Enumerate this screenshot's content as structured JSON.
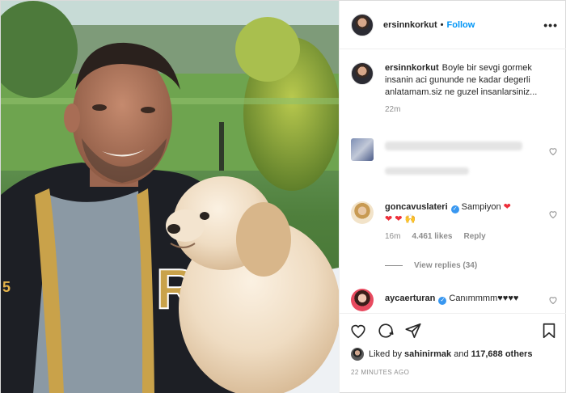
{
  "post": {
    "username": "ersinnkorkut",
    "follow_label": "Follow",
    "more_label": "•••",
    "separator": "•"
  },
  "caption": {
    "username": "ersinnkorkut",
    "text": "Boyle bir sevgi gormek insanin aci gununde ne kadar degerli anlatamam.siz ne guzel insanlarsiniz...",
    "time": "22m"
  },
  "comments": [
    {
      "username": "goncavuslateri",
      "verified": true,
      "text": "Sampiyon",
      "emoji_line": "❤ ❤ 🙌",
      "time": "16m",
      "likes": "4.461 likes",
      "reply_label": "Reply",
      "view_replies": "View replies (34)"
    },
    {
      "username": "aycaerturan",
      "verified": true,
      "text": "Canımmmm♥♥♥♥"
    }
  ],
  "likes": {
    "prefix": "Liked by",
    "user": "sahinirmak",
    "conj": "and",
    "count": "117,688 others"
  },
  "timestamp": "22 MINUTES AGO",
  "colors": {
    "accent": "#0095f6",
    "verified": "#3897f0",
    "heart": "#ed2f3a",
    "muted": "#8e8e8e"
  },
  "icons": [
    "heart-icon",
    "comment-icon",
    "share-icon",
    "bookmark-icon",
    "more-icon",
    "verified-icon"
  ]
}
